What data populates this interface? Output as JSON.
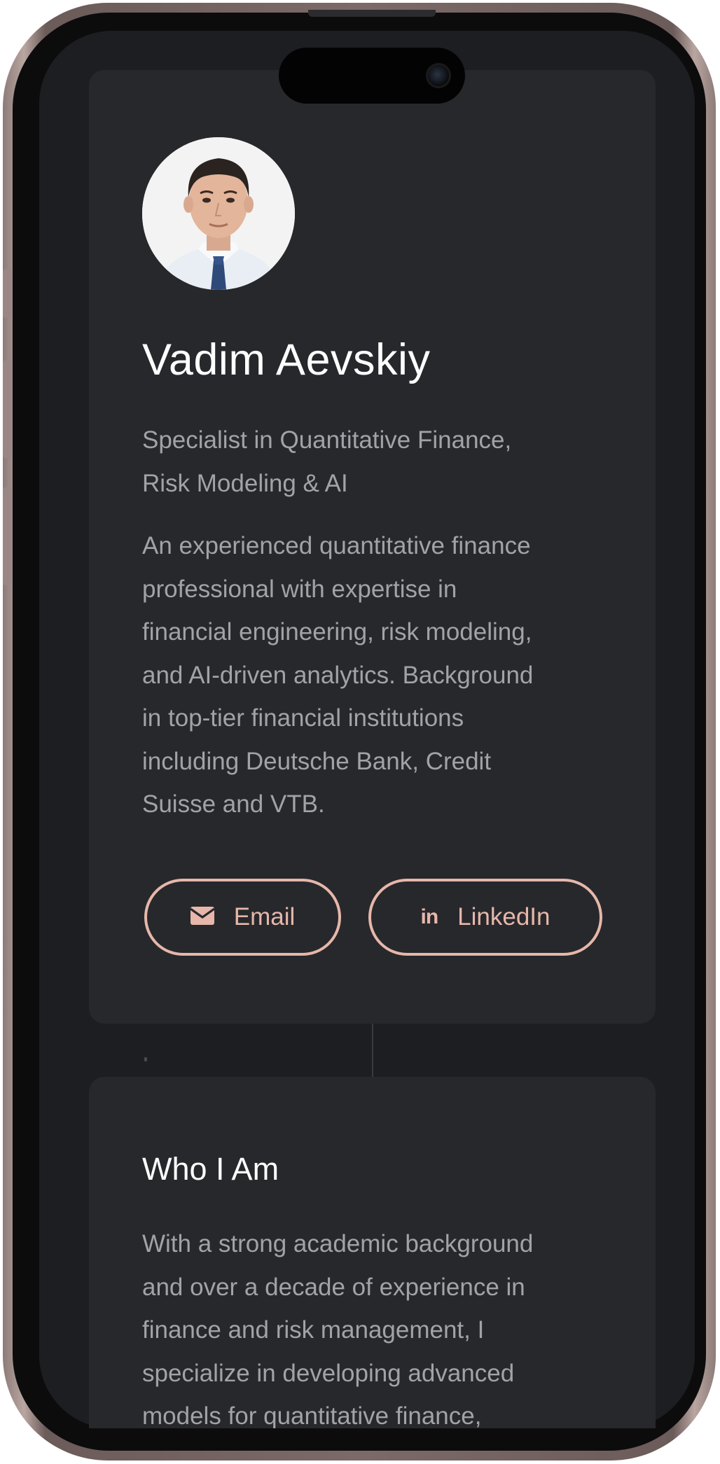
{
  "profile": {
    "name": "Vadim Aevskiy",
    "tagline_line1": "Specialist in Quantitative Finance,",
    "tagline_line2": "Risk Modeling & AI",
    "bio": [
      "An experienced quantitative finance",
      "professional with expertise in",
      "financial engineering, risk modeling,",
      "and AI-driven analytics. Background",
      "in top-tier financial institutions",
      "including Deutsche Bank, Credit",
      "Suisse and VTB."
    ]
  },
  "actions": {
    "email_label": "Email",
    "linkedin_label": "LinkedIn",
    "linkedin_icon_text": "in"
  },
  "about": {
    "heading": "Who I Am",
    "text": [
      "With a strong academic background",
      "and over a decade of experience in",
      "finance and risk management, I",
      "specialize in developing advanced",
      "models for quantitative finance,"
    ]
  },
  "icons": {
    "email": "envelope-icon",
    "linkedin": "linkedin-icon"
  },
  "colors": {
    "accent": "#e6b7aa",
    "card": "#27282c",
    "background": "#1d1e21",
    "text_primary": "#ffffff",
    "text_secondary": "#a2a2a7"
  }
}
